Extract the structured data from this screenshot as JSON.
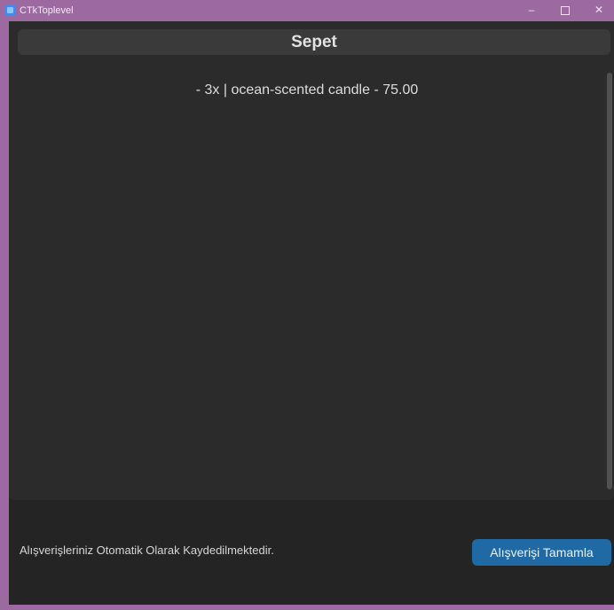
{
  "window": {
    "title": "CTkToplevel",
    "controls": {
      "minimize_glyph": "–",
      "close_glyph": "✕"
    },
    "icon": "app-icon"
  },
  "cart": {
    "title": "Sepet",
    "items": [
      "- 3x | ocean-scented candle - 75.00"
    ]
  },
  "footer": {
    "note": "Alışverişleriniz Otomatik Olarak Kaydedilmektedir.",
    "complete_button_label": "Alışverişi Tamamla"
  },
  "colors": {
    "titlebar": "#9c6aa0",
    "background": "#242424",
    "panel": "#2b2b2b",
    "header": "#3a3a3a",
    "accent": "#1f6aa5"
  }
}
